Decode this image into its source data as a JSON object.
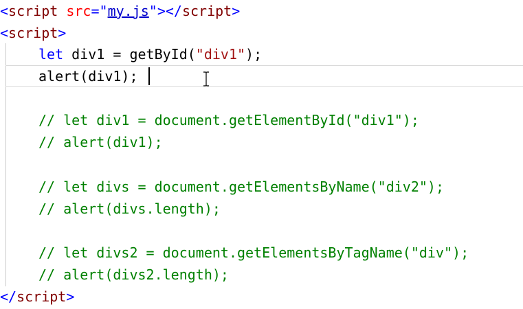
{
  "editor": {
    "lines": [
      {
        "lt": "<",
        "tag": "script",
        "sp": " ",
        "attr": "src",
        "eq": "=",
        "q1": "\"",
        "val": "my.js",
        "q2": "\"",
        "close1": "></",
        "tag2": "script",
        "gt": ">"
      },
      {
        "lt": "<",
        "tag": "script",
        "gt": ">"
      },
      {
        "kw": "let",
        "rest": " div1 = getById(",
        "str": "\"div1\"",
        "end": ");"
      },
      {
        "text": "alert(div1);"
      },
      {
        "comment": "// let div1 = document.getElementById(\"div1\");"
      },
      {
        "comment": "// alert(div1);"
      },
      {
        "comment": "// let divs = document.getElementsByName(\"div2\");"
      },
      {
        "comment": "// alert(divs.length);"
      },
      {
        "comment": "// let divs2 = document.getElementsByTagName(\"div\");"
      },
      {
        "comment": "// alert(divs2.length);"
      },
      {
        "lt": "</",
        "tag": "script",
        "gt": ">"
      }
    ]
  },
  "colors": {
    "tag": "#800000",
    "bracket": "#0000ff",
    "attribute": "#ff0000",
    "string": "#a31515",
    "keyword": "#0000ff",
    "comment": "#008000"
  },
  "icons": {
    "cursor": "text-ibeam-icon"
  }
}
